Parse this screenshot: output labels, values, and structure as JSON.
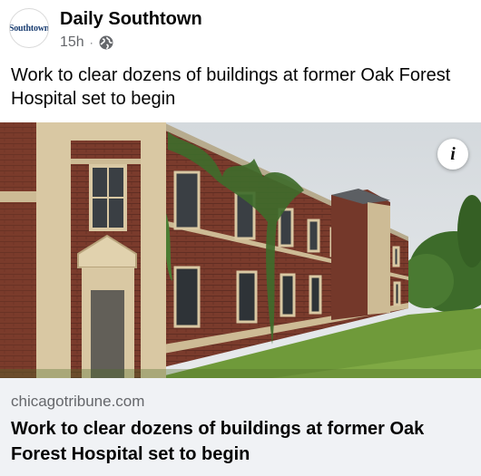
{
  "post": {
    "page_name": "Daily Southtown",
    "avatar_text": "Southtown",
    "time": "15h",
    "separator": "·",
    "privacy_icon": "globe-icon",
    "text": "Work to clear dozens of buildings at former Oak Forest Hospital set to begin"
  },
  "photo": {
    "info_label": "i",
    "info_icon": "info-icon"
  },
  "link": {
    "domain": "chicagotribune.com",
    "title": "Work to clear dozens of buildings at former Oak Forest Hospital set to begin"
  },
  "colors": {
    "secondary_text": "#65676b",
    "preview_bg": "#f0f2f5",
    "brick": "#7a3b2c",
    "limestone": "#d9c8a3",
    "grass": "#6f9a3a"
  }
}
